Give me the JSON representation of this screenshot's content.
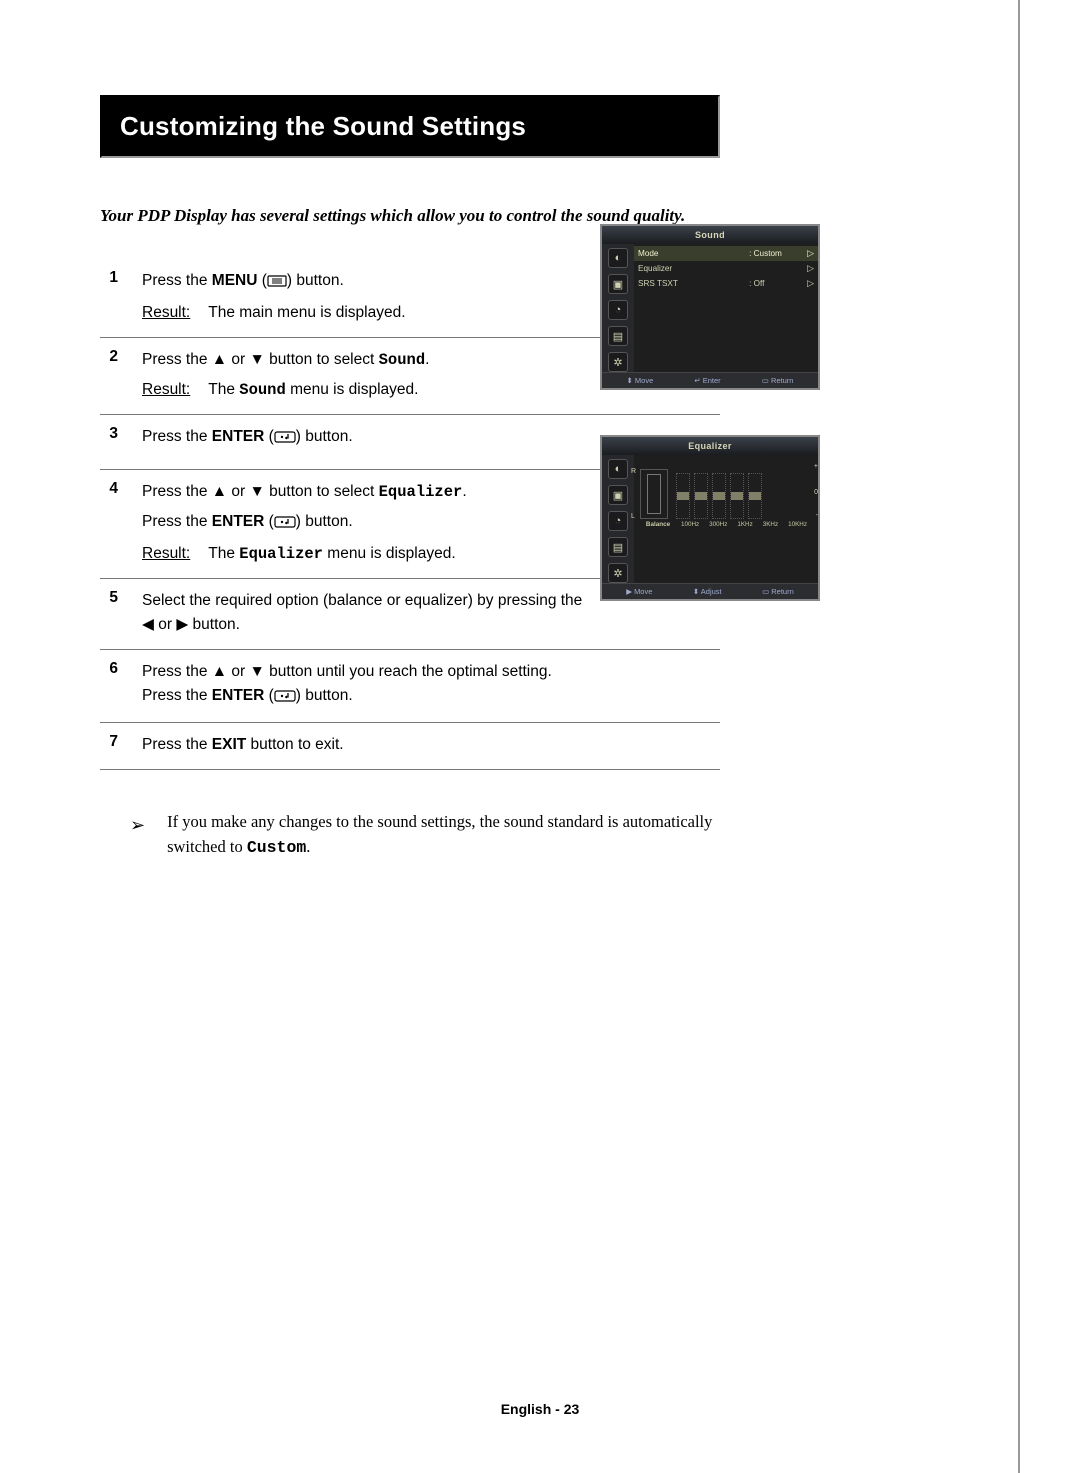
{
  "title": "Customizing the Sound Settings",
  "intro": "Your PDP Display has several settings which allow you to control the sound quality.",
  "result_label": "Result:",
  "steps": {
    "s1": {
      "num": "1",
      "press_prefix": "Press the ",
      "press_bold": "MENU",
      "press_paren_open": " (",
      "press_paren_close": ") button.",
      "result": "The main menu is displayed."
    },
    "s2": {
      "num": "2",
      "press_prefix": "Press the ",
      "press_mid": " button to select ",
      "press_target": "Sound",
      "press_suffix": ".",
      "result_prefix": "The ",
      "result_target": "Sound",
      "result_suffix": " menu is displayed."
    },
    "s3": {
      "num": "3",
      "press_prefix": "Press the ",
      "press_bold": "ENTER",
      "press_paren_open": " (",
      "press_paren_close": ") button."
    },
    "s4": {
      "num": "4",
      "line1_prefix": "Press the ",
      "line1_mid": " button to select ",
      "line1_target": "Equalizer",
      "line1_suffix": ".",
      "line2_prefix": "Press the ",
      "line2_bold": "ENTER",
      "line2_paren_open": " (",
      "line2_paren_close": ") button.",
      "result_prefix": "The ",
      "result_target": "Equalizer",
      "result_suffix": " menu is displayed."
    },
    "s5": {
      "num": "5",
      "line1": "Select the required option (balance or equalizer) by pressing the",
      "line2_mid": " or ",
      "line2_suffix": " button."
    },
    "s6": {
      "num": "6",
      "line1_prefix": "Press the ",
      "line1_mid": " button until you reach the optimal setting.",
      "line2_prefix": "Press the ",
      "line2_bold": "ENTER",
      "line2_paren_open": " (",
      "line2_paren_close": ") button."
    },
    "s7": {
      "num": "7",
      "press_prefix": "Press the ",
      "press_bold": "EXIT",
      "press_suffix": " button to exit."
    }
  },
  "note_prefix": "If you make any changes to the sound settings, the sound standard is automatically switched to ",
  "note_target": "Custom",
  "note_suffix": ".",
  "osd1": {
    "title": "Sound",
    "rows": {
      "mode": {
        "label": "Mode",
        "value": ":  Custom"
      },
      "equalizer": {
        "label": "Equalizer",
        "value": ""
      },
      "srs": {
        "label": "SRS TSXT",
        "value": ":  Off"
      }
    },
    "footer": {
      "move": "Move",
      "enter": "Enter",
      "return": "Return"
    }
  },
  "osd2": {
    "title": "Equalizer",
    "scale": {
      "plus": "+",
      "zero": "0",
      "minus": "-"
    },
    "labels": {
      "r": "R",
      "l": "L",
      "balance": "Balance"
    },
    "bands": [
      "100Hz",
      "300Hz",
      "1KHz",
      "3KHz",
      "10KHz"
    ],
    "footer": {
      "move": "Move",
      "adjust": "Adjust",
      "return": "Return"
    }
  },
  "pagefoot": "English - 23"
}
